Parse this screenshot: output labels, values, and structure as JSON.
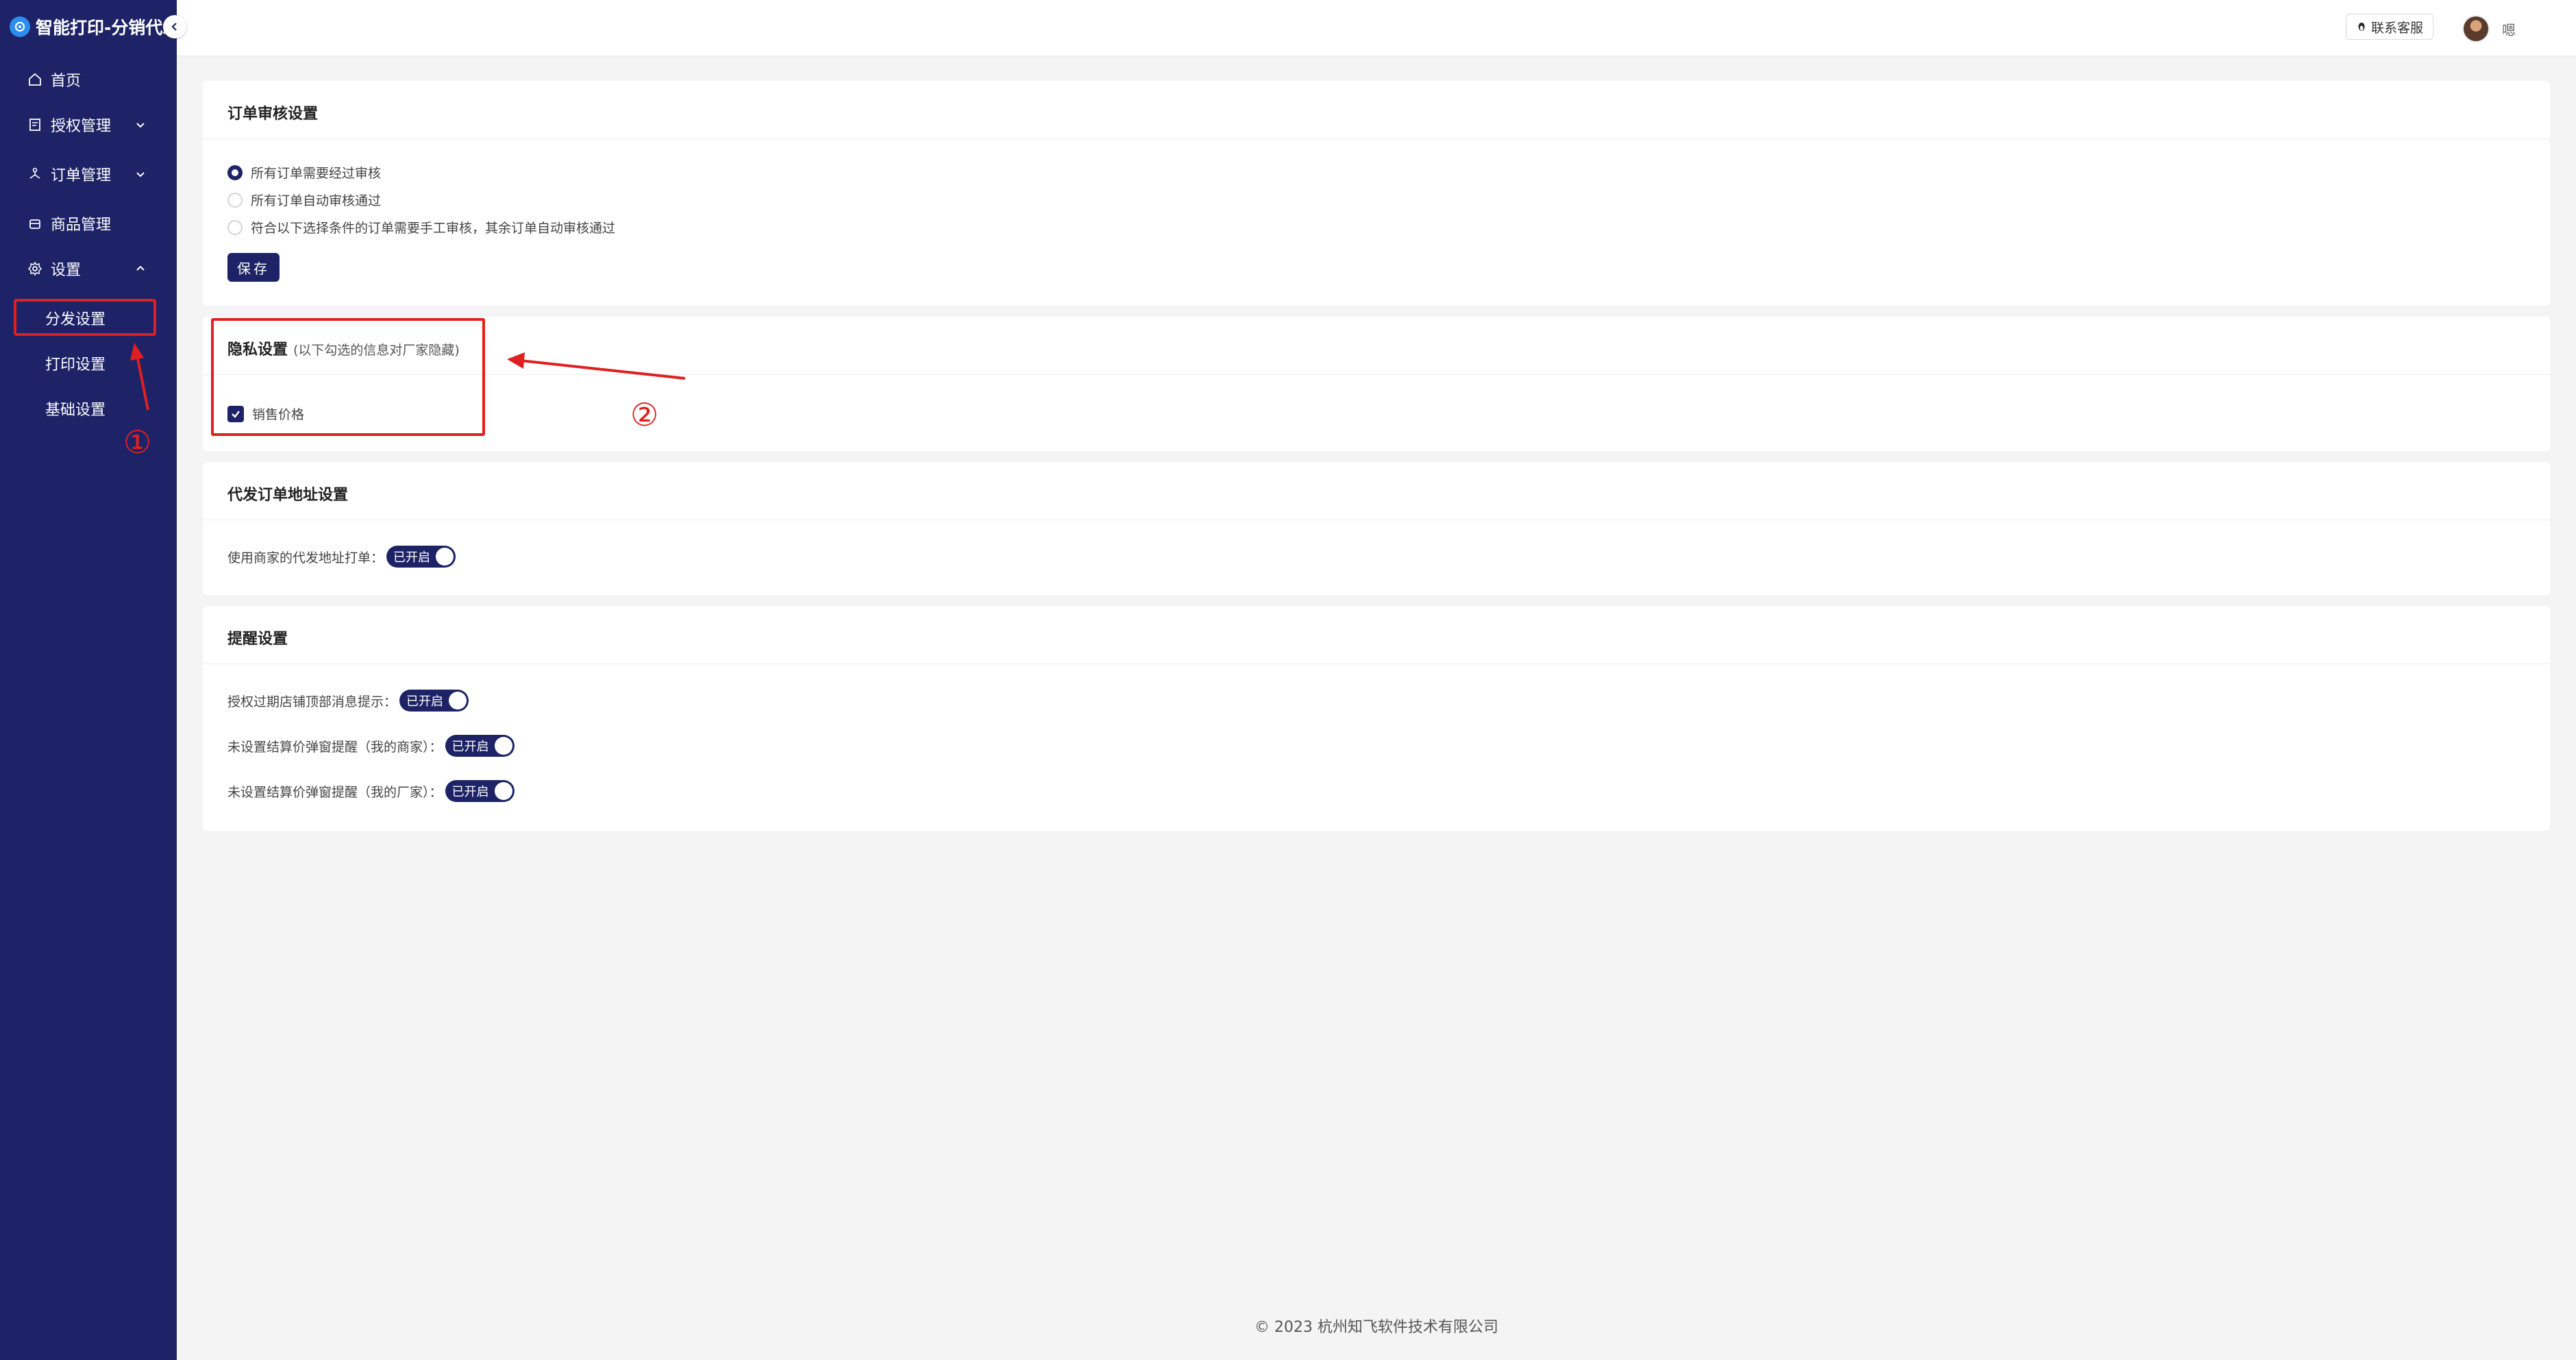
{
  "brand": {
    "title": "智能打印-分销代发"
  },
  "sidebar": {
    "items": [
      {
        "label": "首页",
        "icon": "home-icon"
      },
      {
        "label": "授权管理",
        "icon": "auth-icon"
      },
      {
        "label": "订单管理",
        "icon": "order-icon"
      },
      {
        "label": "商品管理",
        "icon": "product-icon"
      },
      {
        "label": "设置",
        "icon": "gear-icon"
      }
    ],
    "settings_sub": [
      "分发设置",
      "打印设置",
      "基础设置"
    ]
  },
  "header": {
    "contact_label": "联系客服",
    "username": "嗯"
  },
  "order_review": {
    "title": "订单审核设置",
    "options": [
      "所有订单需要经过审核",
      "所有订单自动审核通过",
      "符合以下选择条件的订单需要手工审核，其余订单自动审核通过"
    ],
    "selected_index": 0,
    "save_label": "保存"
  },
  "privacy": {
    "title": "隐私设置",
    "subtitle": "(以下勾选的信息对厂家隐藏)",
    "checkbox_label": "销售价格",
    "checked": true
  },
  "address": {
    "title": "代发订单地址设置",
    "label": "使用商家的代发地址打单：",
    "switch_text": "已开启"
  },
  "reminder": {
    "title": "提醒设置",
    "rows": [
      {
        "label": "授权过期店铺顶部消息提示：",
        "switch_text": "已开启"
      },
      {
        "label": "未设置结算价弹窗提醒（我的商家）：",
        "switch_text": "已开启"
      },
      {
        "label": "未设置结算价弹窗提醒（我的厂家）：",
        "switch_text": "已开启"
      }
    ]
  },
  "annotations": {
    "marker1": "①",
    "marker2": "②"
  },
  "footer": {
    "copyright": "2023 杭州知飞软件技术有限公司"
  },
  "colors": {
    "sidebar_bg": "#1d2366",
    "accent": "#1d2366",
    "annotation": "#e02020"
  }
}
